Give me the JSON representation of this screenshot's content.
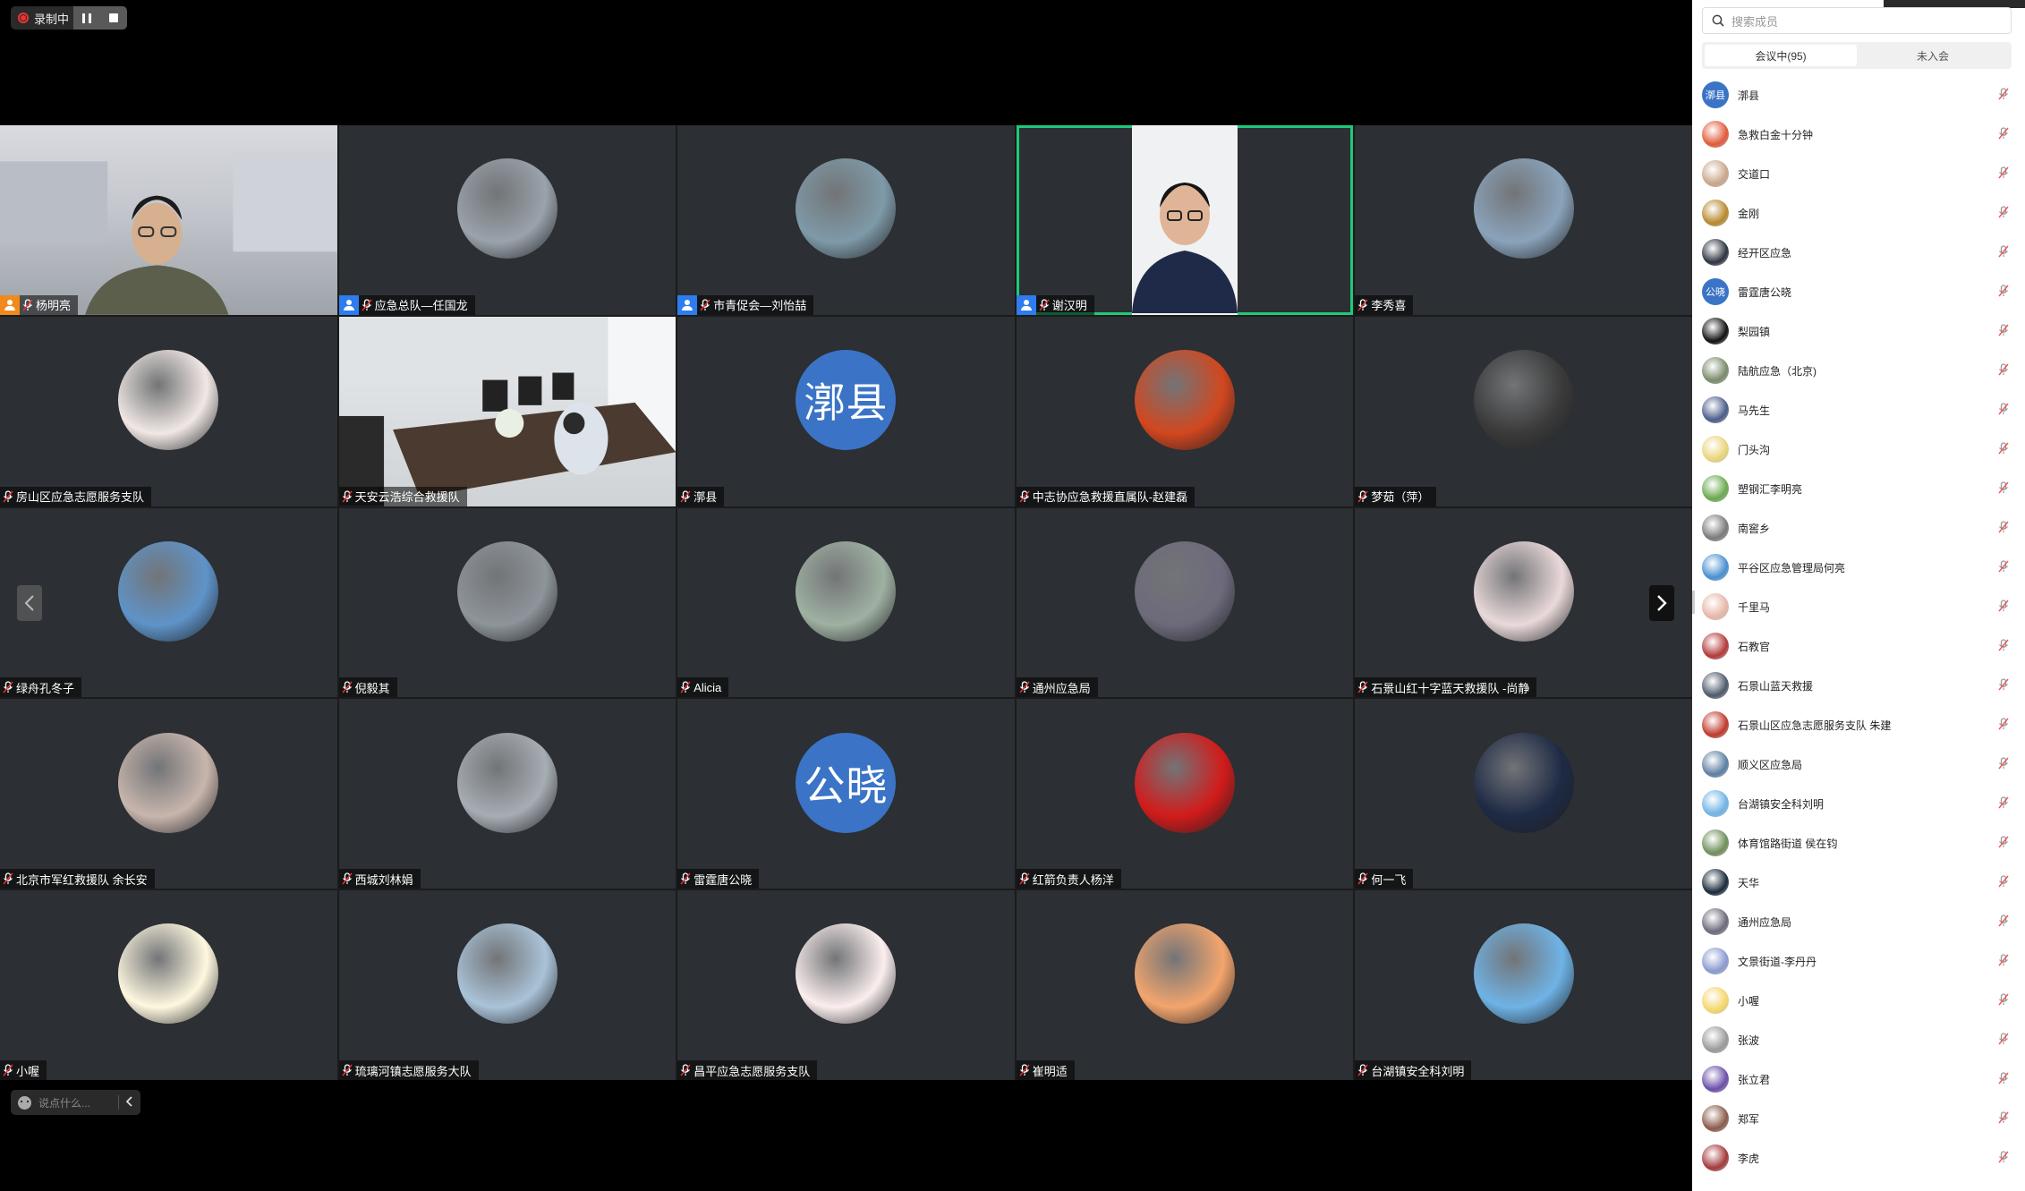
{
  "recording": {
    "label": "录制中"
  },
  "chat": {
    "placeholder": "说点什么..."
  },
  "panel": {
    "search_placeholder": "搜索成员",
    "tabs": [
      {
        "label": "会议中(95)"
      },
      {
        "label": "未入会"
      }
    ]
  },
  "tiles": [
    {
      "name": "杨明亮",
      "kind": "video1",
      "host": "orange"
    },
    {
      "name": "应急总队—任国龙",
      "kind": "avatar",
      "color": "#9aa2ab",
      "host": "blue"
    },
    {
      "name": "市青促会—刘怡喆",
      "kind": "avatar",
      "color": "#7e9aa8",
      "host": "blue"
    },
    {
      "name": "谢汉明",
      "kind": "video2",
      "host": "blue",
      "speaking": true
    },
    {
      "name": "李秀喜",
      "kind": "avatar",
      "color": "#8aa3bb"
    },
    {
      "name": "房山区应急志愿服务支队",
      "kind": "avatar",
      "color": "#f1e8e5"
    },
    {
      "name": "天安云浩综合救援队",
      "kind": "video3"
    },
    {
      "name": "漷县",
      "kind": "text",
      "text": "漷县"
    },
    {
      "name": "中志协应急救援直属队-赵建磊",
      "kind": "avatar",
      "color": "#d2471f"
    },
    {
      "name": "梦茹（萍）",
      "kind": "avatar",
      "color": "#3a3a3a"
    },
    {
      "name": "绿舟孔冬子",
      "kind": "avatar",
      "color": "#5f93c8"
    },
    {
      "name": "倪毅其",
      "kind": "avatar",
      "color": "#8d949a"
    },
    {
      "name": "Alicia",
      "kind": "avatar",
      "color": "#9fb1a2"
    },
    {
      "name": "通州应急局",
      "kind": "avatar",
      "color": "#6d6a7b"
    },
    {
      "name": "石景山红十字蓝天救援队 -尚静",
      "kind": "avatar",
      "color": "#ead9da"
    },
    {
      "name": "北京市军红救援队  余长安",
      "kind": "avatar",
      "color": "#c8b6ad"
    },
    {
      "name": "西城刘林娟",
      "kind": "avatar",
      "color": "#a7adb4"
    },
    {
      "name": "雷霆唐公晓",
      "kind": "text",
      "text": "公晓"
    },
    {
      "name": "红箭负责人杨洋",
      "kind": "avatar",
      "color": "#d21b1b"
    },
    {
      "name": "何一飞",
      "kind": "avatar",
      "color": "#1e2a45"
    },
    {
      "name": "小喔",
      "kind": "avatar",
      "color": "#fff8e0"
    },
    {
      "name": "琉璃河镇志愿服务大队",
      "kind": "avatar",
      "color": "#aac3d8"
    },
    {
      "name": "昌平应急志愿服务支队",
      "kind": "avatar",
      "color": "#fbeeee"
    },
    {
      "name": "崔明适",
      "kind": "avatar",
      "color": "#f3a56d"
    },
    {
      "name": "台湖镇安全科刘明",
      "kind": "avatar",
      "color": "#6fb3e6"
    }
  ],
  "members": [
    {
      "name": "漷县",
      "text": "漷县",
      "color": "#3b74c6"
    },
    {
      "name": "急救白金十分钟",
      "color": "#e05a3a"
    },
    {
      "name": "交道口",
      "color": "#c9a68a"
    },
    {
      "name": "金刚",
      "color": "#b8892e"
    },
    {
      "name": "经开区应急",
      "color": "#2e3440"
    },
    {
      "name": "雷霆唐公晓",
      "text": "公晓",
      "color": "#3b74c6"
    },
    {
      "name": "梨园镇",
      "color": "#111111"
    },
    {
      "name": "陆航应急（北京)",
      "color": "#7a8a6a"
    },
    {
      "name": "马先生",
      "color": "#4a5d8a"
    },
    {
      "name": "门头沟",
      "color": "#e9d47a"
    },
    {
      "name": "塑钢汇李明亮",
      "color": "#6aa84f"
    },
    {
      "name": "南窖乡",
      "color": "#7a7a7a"
    },
    {
      "name": "平谷区应急管理局何亮",
      "color": "#4a8fd0"
    },
    {
      "name": "千里马",
      "color": "#e6b7a9"
    },
    {
      "name": "石教官",
      "color": "#b33a3a"
    },
    {
      "name": "石景山蓝天救援",
      "color": "#4d5a6a"
    },
    {
      "name": "石景山区应急志愿服务支队 朱建",
      "color": "#c0392b"
    },
    {
      "name": "顺义区应急局",
      "color": "#5d7fa3"
    },
    {
      "name": "台湖镇安全科刘明",
      "color": "#6fb3e6"
    },
    {
      "name": "体育馆路街道 侯在钧",
      "color": "#6f8f5a"
    },
    {
      "name": "天华",
      "color": "#1a2a3a"
    },
    {
      "name": "通州应急局",
      "color": "#6d6a7b"
    },
    {
      "name": "文景街道-李丹丹",
      "color": "#8a9ad0"
    },
    {
      "name": "小喔",
      "color": "#f4d66a"
    },
    {
      "name": "张波",
      "color": "#9a9a9a"
    },
    {
      "name": "张立君",
      "color": "#6a4fa8"
    },
    {
      "name": "郑军",
      "color": "#8a5a4a"
    },
    {
      "name": "李虎",
      "color": "#a33a3a"
    }
  ]
}
